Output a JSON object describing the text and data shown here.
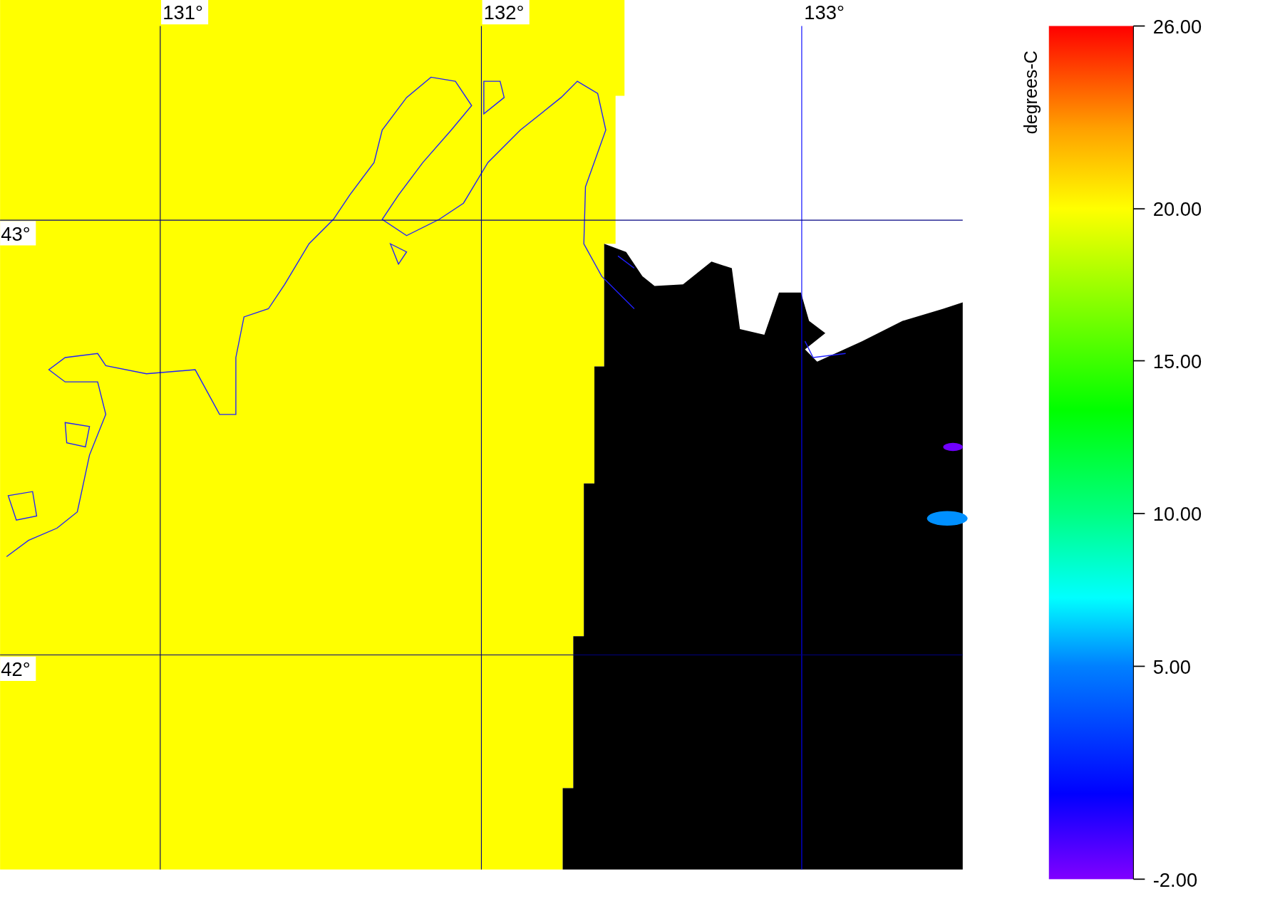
{
  "map": {
    "longitude_labels": [
      "131°",
      "132°",
      "133°"
    ],
    "latitude_labels": [
      "43°",
      "42°"
    ]
  },
  "colorbar": {
    "title": "degrees-C",
    "tick_labels": [
      "26.00",
      "20.00",
      "15.00",
      "10.00",
      "5.00",
      "-2.00"
    ]
  }
}
